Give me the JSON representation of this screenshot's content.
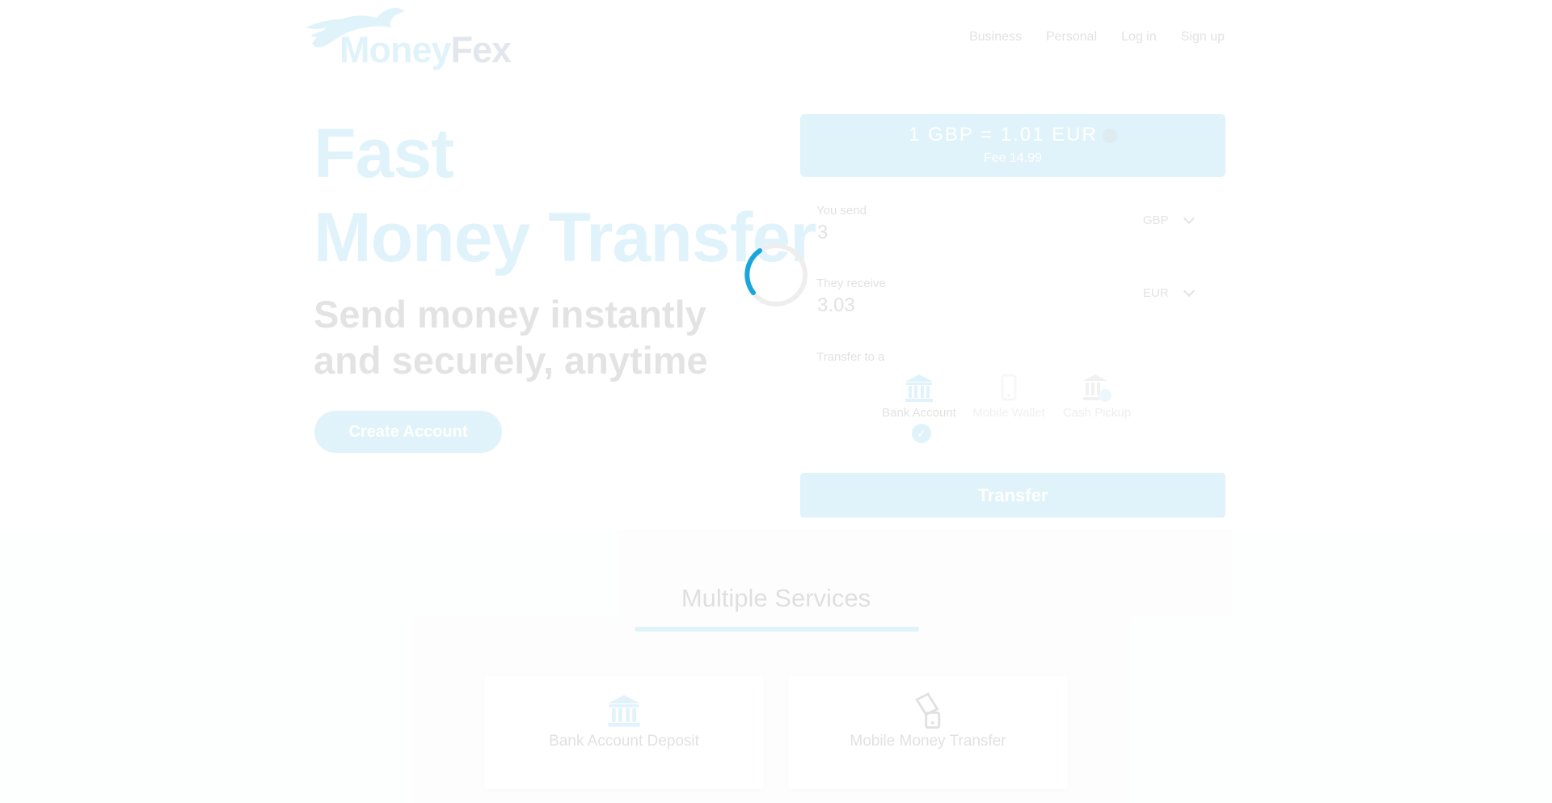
{
  "header": {
    "brand_money": "Money",
    "brand_fex": "Fex",
    "nav": [
      "Business",
      "Personal",
      "Log in",
      "Sign up"
    ]
  },
  "hero": {
    "title_line1": "Fast",
    "title_line2": "Money Transfer",
    "subtitle": "Send money instantly and securely, anytime",
    "cta": "Create Account"
  },
  "calculator": {
    "rate": "1 GBP = 1.01 EUR",
    "fee": "Fee 14.99",
    "send_label": "You send",
    "send_value": "3",
    "send_currency": "GBP",
    "receive_label": "They receive",
    "receive_value": "3.03",
    "receive_currency": "EUR",
    "transfer_to_label": "Transfer to a",
    "options": [
      {
        "label": "Bank Account",
        "icon": "bank-icon",
        "selected": true
      },
      {
        "label": "Mobile Wallet",
        "icon": "mobile-wallet-icon",
        "selected": false
      },
      {
        "label": "Cash Pickup",
        "icon": "cash-pickup-icon",
        "selected": false
      }
    ],
    "transfer_button": "Transfer"
  },
  "services": {
    "title": "Multiple Services",
    "cards": [
      {
        "label": "Bank Account Deposit",
        "icon": "bank-icon"
      },
      {
        "label": "Mobile Money Transfer",
        "icon": "mobile-money-icon"
      }
    ]
  },
  "colors": {
    "accent": "#1aa5dc",
    "brand_dark": "#2a4e7a",
    "spinner": "#1aa5dc"
  },
  "state": {
    "loading": true
  }
}
